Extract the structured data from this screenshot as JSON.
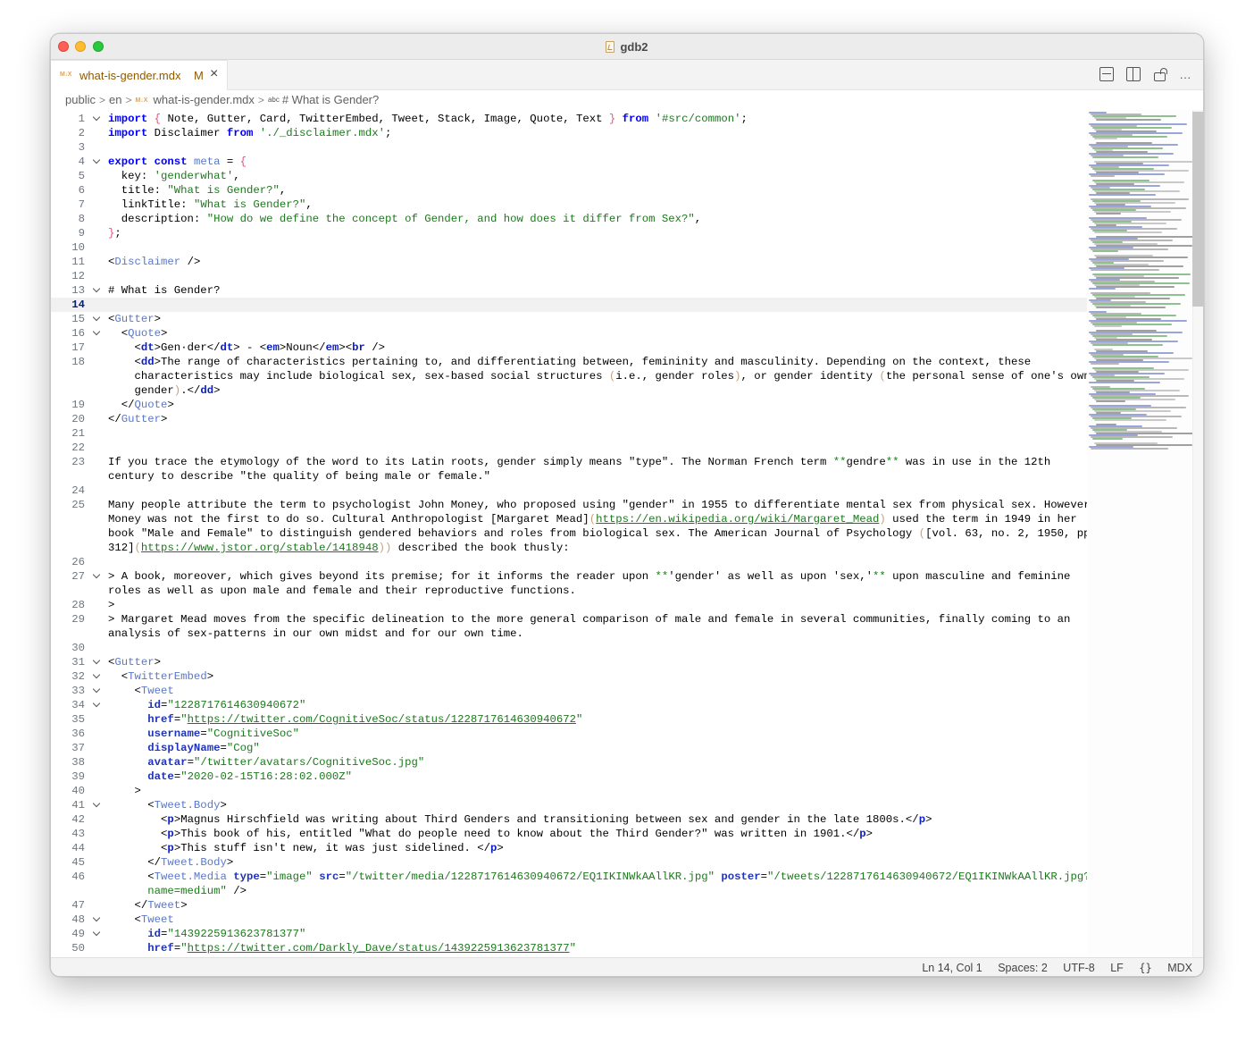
{
  "window": {
    "title": "gdb2"
  },
  "tab": {
    "label": "what-is-gender.mdx",
    "modified": "M",
    "close": "×"
  },
  "tab_actions": {
    "more": "···"
  },
  "breadcrumb": {
    "items": [
      "public",
      "en",
      "what-is-gender.mdx",
      "# What is Gender?"
    ],
    "separator": ">",
    "mdx_icon": "M↓X",
    "symbol_icon": "abc"
  },
  "editor": {
    "current_line": "14",
    "lines": [
      {
        "n": "1",
        "fold": true,
        "html": "<span class=\"kw\">import</span> <span class=\"brk\">{</span> Note, Gutter, Card, TwitterEmbed, Tweet, Stack, Image, Quote, Text <span class=\"brk\">}</span> <span class=\"kw\">from</span> <span class=\"strg\">'#src/common'</span>;"
      },
      {
        "n": "2",
        "html": "<span class=\"kw\">import</span> Disclaimer <span class=\"kw\">from</span> <span class=\"strg\">'./_disclaimer.mdx'</span>;"
      },
      {
        "n": "3",
        "html": ""
      },
      {
        "n": "4",
        "fold": true,
        "html": "<span class=\"kw\">export</span> <span class=\"kw\">const</span> <span class=\"tag\">meta</span> = <span class=\"brk\">{</span>"
      },
      {
        "n": "5",
        "html": "  key: <span class=\"strg\">'genderwhat'</span>,"
      },
      {
        "n": "6",
        "html": "  title: <span class=\"strg\">\"What is Gender?\"</span>,"
      },
      {
        "n": "7",
        "html": "  linkTitle: <span class=\"strg\">\"What is Gender?\"</span>,"
      },
      {
        "n": "8",
        "html": "  description: <span class=\"strg\">\"How do we define the concept of Gender, and how does it differ from Sex?\"</span>,"
      },
      {
        "n": "9",
        "html": "<span class=\"brk\">}</span>;"
      },
      {
        "n": "10",
        "html": ""
      },
      {
        "n": "11",
        "html": "&lt;<span class=\"tag\">Disclaimer</span> /&gt;"
      },
      {
        "n": "12",
        "html": ""
      },
      {
        "n": "13",
        "fold": true,
        "html": "# What is Gender?"
      },
      {
        "n": "14",
        "current": true,
        "html": ""
      },
      {
        "n": "15",
        "fold": true,
        "html": "&lt;<span class=\"tag\">Gutter</span>&gt;"
      },
      {
        "n": "16",
        "fold": true,
        "html": "  &lt;<span class=\"tag\">Quote</span>&gt;"
      },
      {
        "n": "17",
        "html": "    &lt;<span class=\"kwb\">dt</span>&gt;Gen·der&lt;/<span class=\"kwb\">dt</span>&gt; - &lt;<span class=\"kwb\">em</span>&gt;Noun&lt;/<span class=\"kwb\">em</span>&gt;&lt;<span class=\"kwb\">br</span> /&gt;"
      },
      {
        "n": "18",
        "html": "    &lt;<span class=\"kwb\">dd</span>&gt;The range of characteristics pertaining to, and differentiating between, femininity and masculinity. Depending on the context, these"
      },
      {
        "n": "",
        "html": "    characteristics may include biological sex, sex-based social structures <span class=\"par\">(</span>i.e., gender roles<span class=\"par\">)</span>, or gender identity <span class=\"par\">(</span>the personal sense of one's own"
      },
      {
        "n": "",
        "html": "    gender<span class=\"par\">)</span>.&lt;/<span class=\"kwb\">dd</span>&gt;"
      },
      {
        "n": "19",
        "html": "  &lt;/<span class=\"tag\">Quote</span>&gt;"
      },
      {
        "n": "20",
        "html": "&lt;/<span class=\"tag\">Gutter</span>&gt;"
      },
      {
        "n": "21",
        "html": ""
      },
      {
        "n": "22",
        "html": ""
      },
      {
        "n": "23",
        "html": "If you trace the etymology of the word to its Latin roots, gender simply means \"type\". The Norman French term <span class=\"bold\">**</span>gendre<span class=\"bold\">**</span> was in use in the 12th"
      },
      {
        "n": "",
        "html": "century to describe \"the quality of being male or female.\""
      },
      {
        "n": "24",
        "html": ""
      },
      {
        "n": "25",
        "html": "Many people attribute the term to psychologist John Money, who proposed using \"gender\" in 1955 to differentiate mental sex from physical sex. However,"
      },
      {
        "n": "",
        "html": "Money was not the first to do so. Cultural Anthropologist [Margaret Mead]<span class=\"par\">(</span><span class=\"url\">https://en.wikipedia.org/wiki/Margaret_Mead</span><span class=\"par\">)</span> used the term in 1949 in her"
      },
      {
        "n": "",
        "html": "book \"Male and Female\" to distinguish gendered behaviors and roles from biological sex. The American Journal of Psychology <span class=\"par\">(</span>[vol. 63, no. 2, 1950, pp."
      },
      {
        "n": "",
        "html": "312]<span class=\"par\">(</span><span class=\"url\">https://www.jstor.org/stable/1418948</span><span class=\"par\">))</span> described the book thusly:"
      },
      {
        "n": "26",
        "html": ""
      },
      {
        "n": "27",
        "fold": true,
        "html": "&gt; A book, moreover, which gives beyond its premise; for it informs the reader upon <span class=\"bold\">**</span>'gender' as well as upon 'sex,'<span class=\"bold\">**</span> upon masculine and feminine"
      },
      {
        "n": "",
        "html": "roles as well as upon male and female and their reproductive functions."
      },
      {
        "n": "28",
        "html": "&gt;"
      },
      {
        "n": "29",
        "html": "&gt; Margaret Mead moves from the specific delineation to the more general comparison of male and female in several communities, finally coming to an"
      },
      {
        "n": "",
        "html": "analysis of sex-patterns in our own midst and for our own time."
      },
      {
        "n": "30",
        "html": ""
      },
      {
        "n": "31",
        "fold": true,
        "html": "&lt;<span class=\"tag\">Gutter</span>&gt;"
      },
      {
        "n": "32",
        "fold": true,
        "html": "  &lt;<span class=\"tag\">TwitterEmbed</span>&gt;"
      },
      {
        "n": "33",
        "fold": true,
        "html": "    &lt;<span class=\"tag\">Tweet</span>"
      },
      {
        "n": "34",
        "fold": true,
        "html": "      <span class=\"attr\">id</span>=<span class=\"strg\">\"1228717614630940672\"</span>"
      },
      {
        "n": "35",
        "html": "      <span class=\"attr\">href</span>=<span class=\"strg\">\"<span class=\"url\">https://twitter.com/CognitiveSoc/status/1228717614630940672</span>\"</span>"
      },
      {
        "n": "36",
        "html": "      <span class=\"attr\">username</span>=<span class=\"strg\">\"CognitiveSoc\"</span>"
      },
      {
        "n": "37",
        "html": "      <span class=\"attr\">displayName</span>=<span class=\"strg\">\"Cog\"</span>"
      },
      {
        "n": "38",
        "html": "      <span class=\"attr\">avatar</span>=<span class=\"strg\">\"/twitter/avatars/CognitiveSoc.jpg\"</span>"
      },
      {
        "n": "39",
        "html": "      <span class=\"attr\">date</span>=<span class=\"strg\">\"2020-02-15T16:28:02.000Z\"</span>"
      },
      {
        "n": "40",
        "html": "    &gt;"
      },
      {
        "n": "41",
        "fold": true,
        "html": "      &lt;<span class=\"tag\">Tweet.Body</span>&gt;"
      },
      {
        "n": "42",
        "html": "        &lt;<span class=\"kwb\">p</span>&gt;Magnus Hirschfield was writing about Third Genders and transitioning between sex and gender in the late 1800s.&lt;/<span class=\"kwb\">p</span>&gt;"
      },
      {
        "n": "43",
        "html": "        &lt;<span class=\"kwb\">p</span>&gt;This book of his, entitled \"What do people need to know about the Third Gender?\" was written in 1901.&lt;/<span class=\"kwb\">p</span>&gt;"
      },
      {
        "n": "44",
        "html": "        &lt;<span class=\"kwb\">p</span>&gt;This stuff isn't new, it was just sidelined. &lt;/<span class=\"kwb\">p</span>&gt;"
      },
      {
        "n": "45",
        "html": "      &lt;/<span class=\"tag\">Tweet.Body</span>&gt;"
      },
      {
        "n": "46",
        "html": "      &lt;<span class=\"tag\">Tweet.Media</span> <span class=\"attr\">type</span>=<span class=\"strg\">\"image\"</span> <span class=\"attr\">src</span>=<span class=\"strg\">\"/twitter/media/1228717614630940672/EQ1IKINWkAAllKR.jpg\"</span> <span class=\"attr\">poster</span>=<span class=\"strg\">\"/tweets/1228717614630940672/EQ1IKINWkAAllKR.jpg?</span>"
      },
      {
        "n": "",
        "html": "      <span class=\"strg\">name=medium\"</span> /&gt;"
      },
      {
        "n": "47",
        "html": "    &lt;/<span class=\"tag\">Tweet</span>&gt;"
      },
      {
        "n": "48",
        "fold": true,
        "html": "    &lt;<span class=\"tag\">Tweet</span>"
      },
      {
        "n": "49",
        "fold": true,
        "html": "      <span class=\"attr\">id</span>=<span class=\"strg\">\"1439225913623781377\"</span>"
      },
      {
        "n": "50",
        "html": "      <span class=\"attr\">href</span>=<span class=\"strg\">\"<span class=\"url\">https://twitter.com/Darkly_Dave/status/1439225913623781377</span>\"</span>"
      }
    ]
  },
  "status": {
    "position": "Ln 14, Col 1",
    "spaces": "Spaces: 2",
    "encoding": "UTF-8",
    "eol": "LF",
    "braces": "{}",
    "language": "MDX"
  },
  "colors": {
    "accent": "#0000ff",
    "string": "#1b7a1b",
    "tag": "#5a78c8",
    "tab_modified": "#8e5a00"
  }
}
